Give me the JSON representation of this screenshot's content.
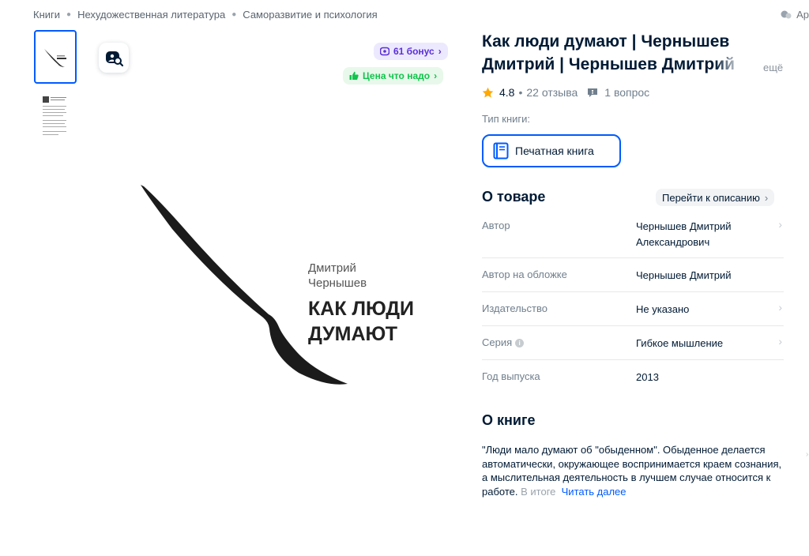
{
  "breadcrumbs": [
    "Книги",
    "Нехудожественная литература",
    "Саморазвитие и психология"
  ],
  "top_right_text": "Ар",
  "badges": {
    "bonus": "61 бонус",
    "price": "Цена что надо"
  },
  "cover": {
    "author_line1": "Дмитрий",
    "author_line2": "Чернышев",
    "title_line1": "КАК ЛЮДИ",
    "title_line2": "ДУМАЮТ"
  },
  "product": {
    "title": "Как люди думают | Чернышев Дмитрий | Чернышев Дмитрий",
    "more": "ещё",
    "rating": "4.8",
    "reviews": "22 отзыва",
    "questions": "1 вопрос",
    "separator": "•"
  },
  "book_type": {
    "label": "Тип книги:",
    "selected": "Печатная книга"
  },
  "about_product": {
    "heading": "О товаре",
    "goto_label": "Перейти к описанию",
    "specs": [
      {
        "name": "Автор",
        "value": "Чернышев Дмитрий Александрович"
      },
      {
        "name": "Автор на обложке",
        "value": "Чернышев Дмитрий"
      },
      {
        "name": "Издательство",
        "value": "Не указано"
      },
      {
        "name": "Серия",
        "value": "Гибкое мышление"
      },
      {
        "name": "Год выпуска",
        "value": "2013"
      }
    ]
  },
  "about_book": {
    "heading": "О книге",
    "text": "\"Люди мало думают об \"обыденном\". Обыденное делается автоматически, окружающее воспринимается краем сознания, а мыслительная деятельность в лучшем случае относится к работе.",
    "text_faded": "В итоге",
    "read_more": "Читать далее"
  },
  "colors": {
    "accent": "#005bff",
    "bonus_text": "#5b2fd6",
    "price_text": "#10c44c",
    "star": "#ffa800"
  }
}
